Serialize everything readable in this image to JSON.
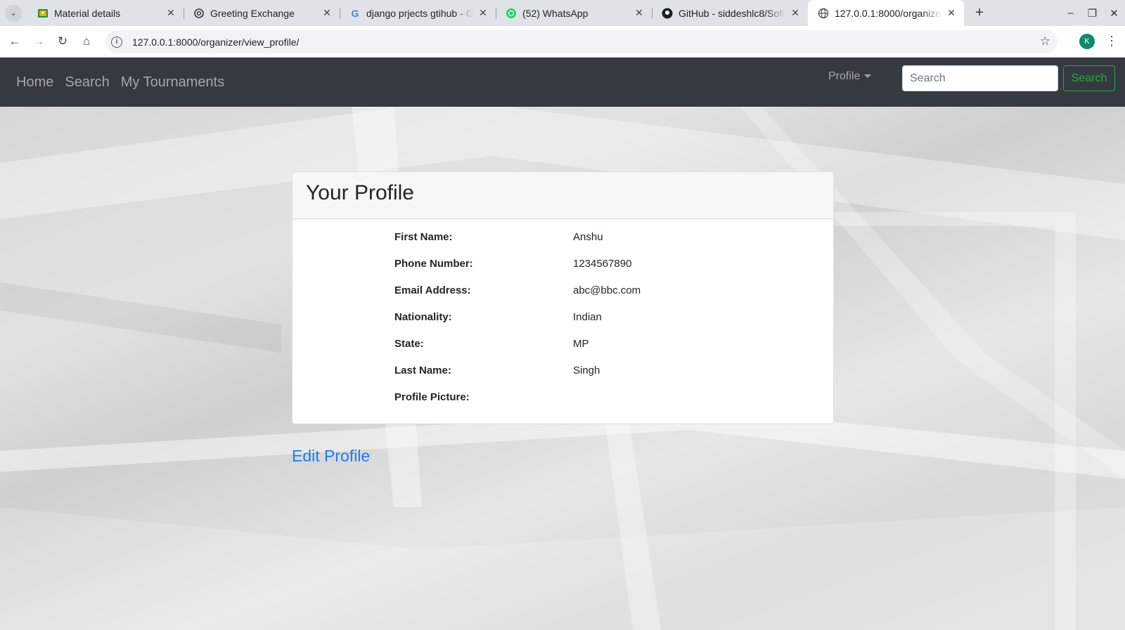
{
  "browser": {
    "tabs": [
      {
        "title": "Material details",
        "favicon": "classroom-icon",
        "active": false
      },
      {
        "title": "Greeting Exchange",
        "favicon": "chatgpt-icon",
        "active": false
      },
      {
        "title": "django prjects gtihub - Goo",
        "favicon": "google-icon",
        "active": false
      },
      {
        "title": "(52) WhatsApp",
        "favicon": "whatsapp-icon",
        "active": false
      },
      {
        "title": "GitHub - siddeshlc8/Softw",
        "favicon": "github-icon",
        "active": false
      },
      {
        "title": "127.0.0.1:8000/organizer/v",
        "favicon": "globe-icon",
        "active": true
      }
    ],
    "url": "127.0.0.1:8000/organizer/view_profile/",
    "avatar_letter": "K"
  },
  "navbar": {
    "links": [
      "Home",
      "Search",
      "My Tournaments"
    ],
    "profile_label": "Profile",
    "search_placeholder": "Search",
    "search_button": "Search"
  },
  "profile": {
    "title": "Your Profile",
    "fields": [
      {
        "label": "First Name:",
        "value": "Anshu"
      },
      {
        "label": "Phone Number:",
        "value": "1234567890"
      },
      {
        "label": "Email Address:",
        "value": "abc@bbc.com"
      },
      {
        "label": "Nationality:",
        "value": "Indian"
      },
      {
        "label": "State:",
        "value": "MP"
      },
      {
        "label": "Last Name:",
        "value": "Singh"
      },
      {
        "label": "Profile Picture:",
        "value": ""
      }
    ],
    "edit_label": "Edit Profile"
  },
  "colors": {
    "navbar_bg": "#343a40",
    "search_button": "#28a745",
    "link": "#1a7bff",
    "avatar_bg": "#0f8a6e"
  }
}
